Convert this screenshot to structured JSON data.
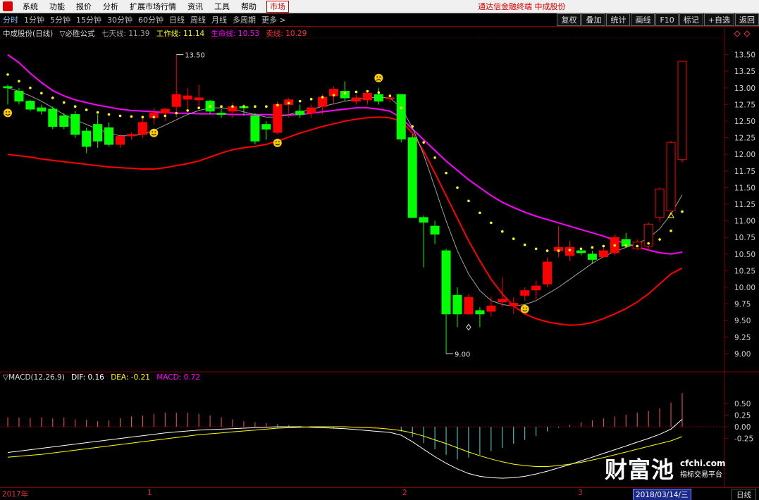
{
  "menu": {
    "items": [
      "系统",
      "功能",
      "报价",
      "分析",
      "扩展市场行情",
      "资讯",
      "工具",
      "帮助"
    ],
    "active_item": "市场",
    "center_title": "通达信金融终端  中成股份"
  },
  "toolbar": {
    "periods": [
      "分时",
      "1分钟",
      "5分钟",
      "15分钟",
      "30分钟",
      "60分钟",
      "日线",
      "周线",
      "月线",
      "多周期",
      "更多 >"
    ],
    "selected_period": "分时",
    "right_buttons": [
      "复权",
      "叠加",
      "统计",
      "画线",
      "F10",
      "标记",
      "+自选",
      "返回"
    ]
  },
  "main_info": {
    "stock": "中成股份(日线)",
    "formula": "▽必胜公式",
    "qiantian_label": "七天线: 11.39",
    "gongzuo_label": "工作线: 11.14",
    "shengming_label": "生命线: 10.53",
    "mai_label": "卖线: 10.29"
  },
  "macd_info": {
    "title": "▽MACD(12,26,9)",
    "dif": "DIF: 0.16",
    "dea": "DEA: -0.21",
    "macd": "MACD: 0.72"
  },
  "colors": {
    "up": "#ff0000",
    "down": "#00ff00",
    "life_line": "#ff00ff",
    "sell_line": "#ff0000",
    "work_dots": "#ffff00",
    "seven_line": "#a0a0a0",
    "grid": "#800000"
  },
  "chart_data": {
    "type": "candlestick",
    "y_ticks": [
      "13.50",
      "13.25",
      "13.00",
      "12.75",
      "12.50",
      "12.25",
      "12.00",
      "11.75",
      "11.50",
      "11.25",
      "11.00",
      "10.75",
      "10.50",
      "10.25",
      "10.00",
      "9.75",
      "9.50",
      "9.25",
      "9.00"
    ],
    "ylim": [
      8.75,
      13.75
    ],
    "high_label": "13.50",
    "low_label": "9.00",
    "candles": [
      [
        13.02,
        13.05,
        12.75,
        13.0
      ],
      [
        12.95,
        13.0,
        12.75,
        12.8
      ],
      [
        12.8,
        12.82,
        12.65,
        12.68
      ],
      [
        12.7,
        12.75,
        12.6,
        12.65
      ],
      [
        12.68,
        12.72,
        12.38,
        12.42
      ],
      [
        12.58,
        12.62,
        12.38,
        12.42
      ],
      [
        12.6,
        12.65,
        12.25,
        12.3
      ],
      [
        12.35,
        12.4,
        12.02,
        12.12
      ],
      [
        12.45,
        12.6,
        12.1,
        12.2
      ],
      [
        12.4,
        12.48,
        12.12,
        12.15
      ],
      [
        12.15,
        12.3,
        12.1,
        12.27
      ],
      [
        12.28,
        12.33,
        12.22,
        12.3
      ],
      [
        12.3,
        12.55,
        12.25,
        12.48
      ],
      [
        12.55,
        12.7,
        12.45,
        12.62
      ],
      [
        12.62,
        12.7,
        12.5,
        12.68
      ],
      [
        12.72,
        13.5,
        12.55,
        12.9
      ],
      [
        12.83,
        13.0,
        12.65,
        12.88
      ],
      [
        12.82,
        13.05,
        12.7,
        12.85
      ],
      [
        12.8,
        12.82,
        12.6,
        12.65
      ],
      [
        12.62,
        12.68,
        12.55,
        12.6
      ],
      [
        12.65,
        12.78,
        12.55,
        12.72
      ],
      [
        12.72,
        12.75,
        12.58,
        12.7
      ],
      [
        12.58,
        12.62,
        12.15,
        12.2
      ],
      [
        12.45,
        12.5,
        12.22,
        12.38
      ],
      [
        12.33,
        12.8,
        12.3,
        12.75
      ],
      [
        12.75,
        12.85,
        12.55,
        12.82
      ],
      [
        12.65,
        12.75,
        12.55,
        12.6
      ],
      [
        12.62,
        12.75,
        12.55,
        12.7
      ],
      [
        12.72,
        12.9,
        12.6,
        12.86
      ],
      [
        12.88,
        13.02,
        12.75,
        12.98
      ],
      [
        12.95,
        13.1,
        12.8,
        12.85
      ],
      [
        12.8,
        12.9,
        12.75,
        12.85
      ],
      [
        12.82,
        12.95,
        12.75,
        12.92
      ],
      [
        12.9,
        13.0,
        12.75,
        12.8
      ],
      [
        12.85,
        12.92,
        12.78,
        12.85
      ],
      [
        12.9,
        12.9,
        12.18,
        12.23
      ],
      [
        12.25,
        12.3,
        11.05,
        11.05
      ],
      [
        11.05,
        11.08,
        10.3,
        10.98
      ],
      [
        10.92,
        11.0,
        10.65,
        10.8
      ],
      [
        10.55,
        10.58,
        9.0,
        9.6
      ],
      [
        9.88,
        10.0,
        9.4,
        9.6
      ],
      [
        9.6,
        9.9,
        9.58,
        9.85
      ],
      [
        9.65,
        9.7,
        9.4,
        9.6
      ],
      [
        9.64,
        9.86,
        9.56,
        9.72
      ],
      [
        9.78,
        10.15,
        9.7,
        9.82
      ],
      [
        9.72,
        9.85,
        9.6,
        9.76
      ],
      [
        9.88,
        10.0,
        9.8,
        9.95
      ],
      [
        9.96,
        10.1,
        9.82,
        10.02
      ],
      [
        10.05,
        10.45,
        10.0,
        10.38
      ],
      [
        10.55,
        10.92,
        10.45,
        10.6
      ],
      [
        10.48,
        10.7,
        10.4,
        10.6
      ],
      [
        10.55,
        10.6,
        10.48,
        10.52
      ],
      [
        10.5,
        10.55,
        10.35,
        10.42
      ],
      [
        10.46,
        10.6,
        10.45,
        10.55
      ],
      [
        10.52,
        10.8,
        10.48,
        10.75
      ],
      [
        10.72,
        10.82,
        10.6,
        10.62
      ],
      [
        10.58,
        10.72,
        10.56,
        10.68
      ],
      [
        10.62,
        10.98,
        10.55,
        10.95
      ],
      [
        11.05,
        11.5,
        10.98,
        11.48
      ],
      [
        11.15,
        12.2,
        11.1,
        12.18
      ],
      [
        11.92,
        13.4,
        11.88,
        13.4
      ]
    ],
    "life_line": [
      13.5,
      13.38,
      13.22,
      13.08,
      12.96,
      12.88,
      12.82,
      12.78,
      12.74,
      12.71,
      12.68,
      12.66,
      12.65,
      12.64,
      12.63,
      12.62,
      12.62,
      12.61,
      12.61,
      12.61,
      12.6,
      12.6,
      12.6,
      12.6,
      12.59,
      12.59,
      12.6,
      12.62,
      12.64,
      12.66,
      12.68,
      12.7,
      12.7,
      12.68,
      12.65,
      12.55,
      12.38,
      12.22,
      12.06,
      11.9,
      11.76,
      11.62,
      11.5,
      11.38,
      11.28,
      11.2,
      11.13,
      11.07,
      11.02,
      10.97,
      10.92,
      10.87,
      10.82,
      10.77,
      10.71,
      10.66,
      10.61,
      10.56,
      10.52,
      10.5,
      10.53
    ],
    "sell_line": [
      12.0,
      11.98,
      11.96,
      11.93,
      11.91,
      11.89,
      11.87,
      11.85,
      11.83,
      11.81,
      11.8,
      11.79,
      11.78,
      11.78,
      11.8,
      11.83,
      11.86,
      11.9,
      11.96,
      12.02,
      12.07,
      12.1,
      12.12,
      12.15,
      12.2,
      12.26,
      12.32,
      12.37,
      12.42,
      12.46,
      12.5,
      12.53,
      12.55,
      12.56,
      12.55,
      12.5,
      12.32,
      12.05,
      11.72,
      11.38,
      11.04,
      10.7,
      10.4,
      10.12,
      9.9,
      9.72,
      9.6,
      9.53,
      9.48,
      9.45,
      9.43,
      9.44,
      9.47,
      9.53,
      9.6,
      9.68,
      9.78,
      9.9,
      10.05,
      10.2,
      10.29
    ],
    "seven_line": [
      13.0,
      12.95,
      12.88,
      12.8,
      12.7,
      12.6,
      12.52,
      12.45,
      12.38,
      12.32,
      12.28,
      12.28,
      12.3,
      12.36,
      12.44,
      12.52,
      12.6,
      12.66,
      12.7,
      12.7,
      12.68,
      12.64,
      12.6,
      12.56,
      12.56,
      12.6,
      12.64,
      12.68,
      12.72,
      12.76,
      12.8,
      12.83,
      12.85,
      12.86,
      12.85,
      12.7,
      12.4,
      12.0,
      11.5,
      11.0,
      10.55,
      10.2,
      9.95,
      9.8,
      9.74,
      9.72,
      9.74,
      9.8,
      9.9,
      10.0,
      10.12,
      10.24,
      10.36,
      10.46,
      10.54,
      10.6,
      10.66,
      10.74,
      10.88,
      11.1,
      11.39
    ],
    "work_dots": [
      13.2,
      13.1,
      13.0,
      12.92,
      12.85,
      12.78,
      12.72,
      12.67,
      12.63,
      12.6,
      12.58,
      12.57,
      12.56,
      12.56,
      12.58,
      12.62,
      12.66,
      12.7,
      12.72,
      12.72,
      12.72,
      12.72,
      12.72,
      12.72,
      12.74,
      12.77,
      12.8,
      12.83,
      12.86,
      12.89,
      12.92,
      12.94,
      12.95,
      12.93,
      12.88,
      12.7,
      12.42,
      12.18,
      11.95,
      11.72,
      11.5,
      11.3,
      11.12,
      10.97,
      10.84,
      10.73,
      10.64,
      10.58,
      10.55,
      10.55,
      10.56,
      10.58,
      10.6,
      10.62,
      10.63,
      10.63,
      10.62,
      10.66,
      10.72,
      10.85,
      11.14
    ],
    "macd_hist": [
      0.2,
      0.2,
      0.19,
      0.2,
      0.18,
      0.2,
      0.16,
      0.15,
      0.12,
      0.14,
      0.18,
      0.22,
      0.24,
      0.28,
      0.3,
      0.3,
      0.3,
      0.28,
      0.24,
      0.2,
      0.16,
      0.12,
      0.1,
      0.08,
      0.06,
      0.04,
      0.02,
      0.01,
      0.0,
      -0.02,
      0.0,
      0.0,
      0.0,
      0.0,
      0.0,
      -0.1,
      -0.22,
      -0.35,
      -0.48,
      -0.6,
      -0.7,
      -0.66,
      -0.6,
      -0.52,
      -0.45,
      -0.36,
      -0.28,
      -0.2,
      -0.1,
      -0.02,
      0.04,
      0.1,
      0.14,
      0.18,
      0.22,
      0.26,
      0.3,
      0.34,
      0.4,
      0.52,
      0.72
    ],
    "dif": [
      -0.55,
      -0.52,
      -0.49,
      -0.46,
      -0.43,
      -0.4,
      -0.37,
      -0.34,
      -0.31,
      -0.28,
      -0.25,
      -0.22,
      -0.19,
      -0.16,
      -0.13,
      -0.11,
      -0.09,
      -0.07,
      -0.06,
      -0.05,
      -0.04,
      -0.03,
      -0.02,
      -0.01,
      0.0,
      0.0,
      0.0,
      -0.01,
      -0.02,
      -0.03,
      -0.04,
      -0.06,
      -0.08,
      -0.1,
      -0.12,
      -0.18,
      -0.32,
      -0.48,
      -0.64,
      -0.78,
      -0.9,
      -1.0,
      -1.06,
      -1.09,
      -1.1,
      -1.09,
      -1.06,
      -1.01,
      -0.95,
      -0.88,
      -0.81,
      -0.73,
      -0.65,
      -0.57,
      -0.49,
      -0.41,
      -0.33,
      -0.25,
      -0.16,
      -0.05,
      0.16
    ],
    "dea": [
      -0.65,
      -0.63,
      -0.61,
      -0.59,
      -0.56,
      -0.53,
      -0.5,
      -0.47,
      -0.44,
      -0.41,
      -0.38,
      -0.35,
      -0.32,
      -0.29,
      -0.26,
      -0.23,
      -0.2,
      -0.17,
      -0.15,
      -0.13,
      -0.11,
      -0.09,
      -0.07,
      -0.05,
      -0.03,
      -0.02,
      -0.01,
      0.0,
      0.0,
      0.0,
      0.0,
      -0.01,
      -0.02,
      -0.03,
      -0.05,
      -0.08,
      -0.13,
      -0.2,
      -0.28,
      -0.36,
      -0.45,
      -0.54,
      -0.62,
      -0.69,
      -0.75,
      -0.8,
      -0.83,
      -0.85,
      -0.85,
      -0.83,
      -0.8,
      -0.76,
      -0.71,
      -0.66,
      -0.6,
      -0.54,
      -0.48,
      -0.42,
      -0.36,
      -0.3,
      -0.21
    ],
    "macd_ticks": [
      "0.50",
      "0.25",
      "0.00",
      "-0.25"
    ],
    "macd_ylim": [
      -1.25,
      0.95
    ],
    "smileys_happy": [
      0,
      13,
      24,
      46
    ],
    "smileys_sad": [
      33
    ]
  },
  "bottom": {
    "year": "2017年",
    "months": [
      "1",
      "2",
      "3"
    ],
    "date": "2018/03/14/三",
    "period": "日线"
  },
  "watermark": {
    "brand": "财富池",
    "site": "cfchi.com",
    "tag": "指标交易平台"
  }
}
